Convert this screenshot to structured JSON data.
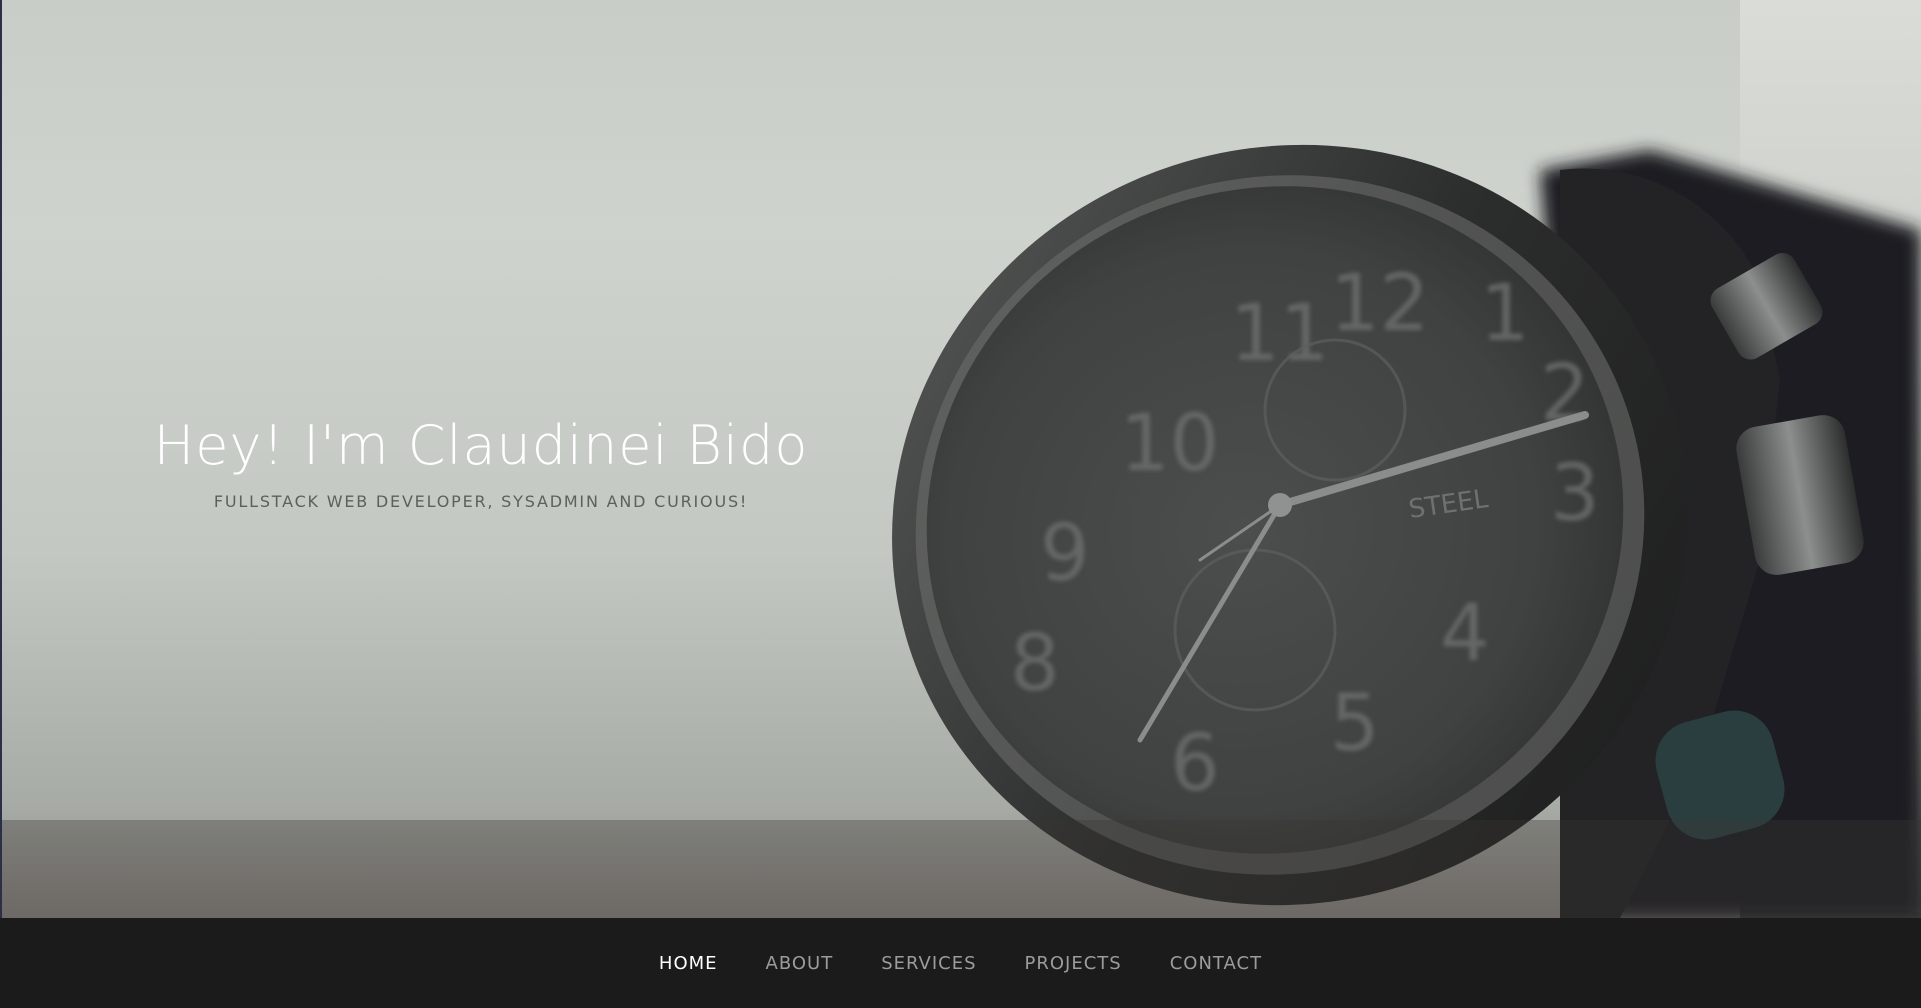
{
  "hero": {
    "title": "Hey! I'm Claudinei Bido",
    "subtitle": "FULLSTACK WEB DEVELOPER, SYSADMIN AND CURIOUS!",
    "image": "watch-closeup-photo"
  },
  "navbar": {
    "items": [
      {
        "label": "HOME",
        "active": true
      },
      {
        "label": "ABOUT",
        "active": false
      },
      {
        "label": "SERVICES",
        "active": false
      },
      {
        "label": "PROJECTS",
        "active": false
      },
      {
        "label": "CONTACT",
        "active": false
      }
    ]
  },
  "colors": {
    "navbar_bg": "#1b1b1b",
    "nav_active": "#ffffff",
    "nav_inactive": "#9c9c9c",
    "title": "#ffffff",
    "subtitle": "#5d615c"
  }
}
